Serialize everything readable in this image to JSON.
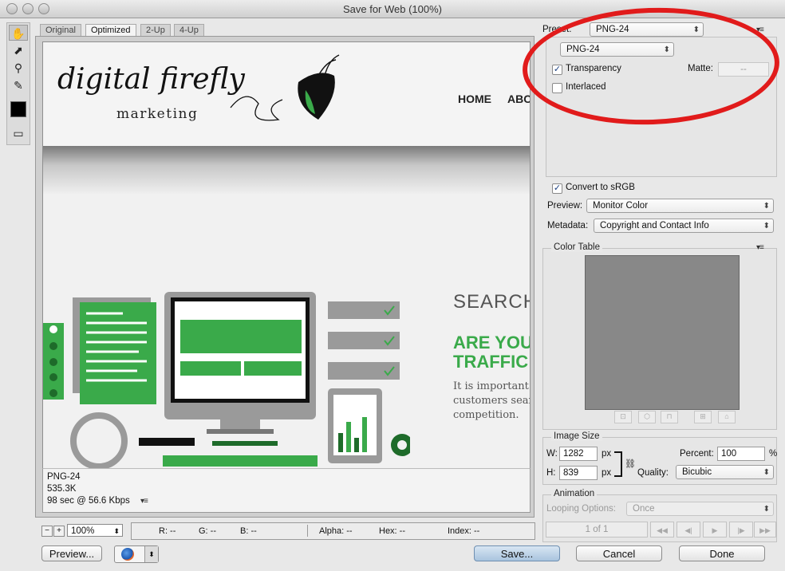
{
  "window": {
    "title": "Save for Web (100%)"
  },
  "tabs": [
    "Original",
    "Optimized",
    "2-Up",
    "4-Up"
  ],
  "active_tab": "Optimized",
  "tools": [
    "hand-tool-icon",
    "slice-select-tool-icon",
    "zoom-tool-icon",
    "eyedropper-tool-icon",
    "eyedropper-color-swatch",
    "toggle-slices-icon"
  ],
  "site": {
    "logo_main": "digital firefly",
    "logo_sub": "marketing",
    "nav": [
      "HOME",
      "ABC"
    ],
    "heading1": "SEARCH",
    "heading2a": "ARE YOU",
    "heading2b": "TRAFFIC T",
    "body_lines": [
      "It is important f",
      "customers searc",
      "competition."
    ],
    "accent": "#3aaa4a"
  },
  "info": {
    "format": "PNG-24",
    "size": "535.3K",
    "time": "98 sec @ 56.6 Kbps"
  },
  "status": {
    "zoom": "100%",
    "r": "R: --",
    "g": "G: --",
    "b": "B: --",
    "alpha": "Alpha: --",
    "hex": "Hex: --",
    "index": "Index: --"
  },
  "buttons": {
    "preview": "Preview...",
    "save": "Save...",
    "cancel": "Cancel",
    "done": "Done"
  },
  "preset": {
    "label": "Preset:",
    "value": "PNG-24",
    "format_value": "PNG-24"
  },
  "options": {
    "transparency": "Transparency",
    "transparency_checked": true,
    "matte_label": "Matte:",
    "matte_value": "--",
    "interlaced": "Interlaced",
    "interlaced_checked": false,
    "convert_srgb": "Convert to sRGB",
    "convert_checked": true,
    "preview_label": "Preview:",
    "preview_value": "Monitor Color",
    "metadata_label": "Metadata:",
    "metadata_value": "Copyright and Contact Info"
  },
  "color_table": {
    "title": "Color Table",
    "swatch_color": "#888888"
  },
  "image_size": {
    "title": "Image Size",
    "w_label": "W:",
    "w_value": "1282",
    "h_label": "H:",
    "h_value": "839",
    "unit": "px",
    "percent_label": "Percent:",
    "percent_value": "100",
    "percent_unit": "%",
    "quality_label": "Quality:",
    "quality_value": "Bicubic"
  },
  "animation": {
    "title": "Animation",
    "looping_label": "Looping Options:",
    "looping_value": "Once",
    "frame": "1 of 1"
  },
  "annotation_color": "#e11b1b"
}
